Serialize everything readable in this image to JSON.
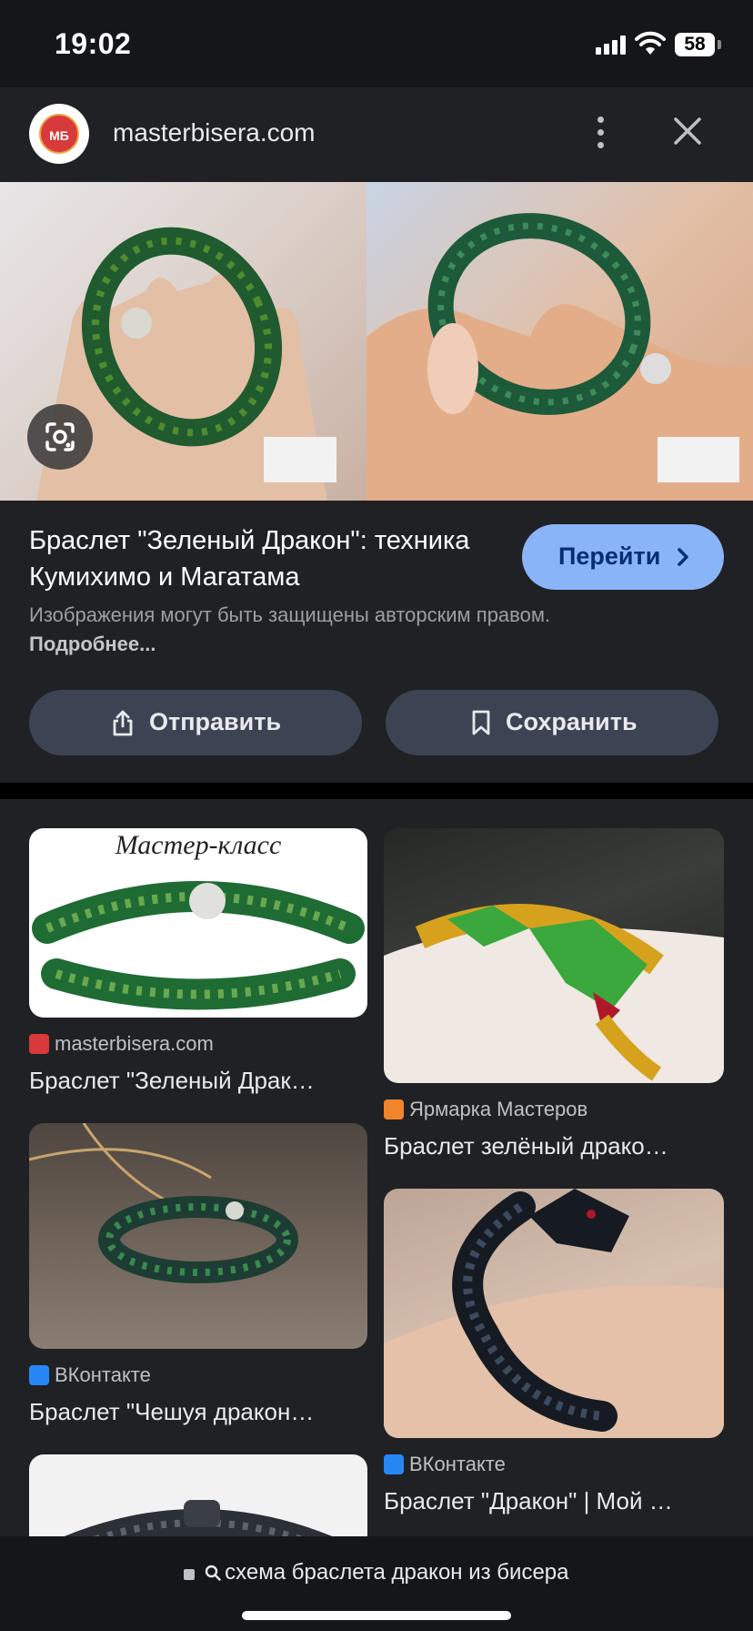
{
  "status": {
    "time": "19:02",
    "battery": "58"
  },
  "header": {
    "logo_text": "МБ",
    "site": "masterbisera.com"
  },
  "preview": {
    "title": "Браслет \"Зеленый Дракон\": техника Кумихимо и Магатама",
    "go_label": "Перейти",
    "copyright_text": "Изображения могут быть защищены авторским правом.",
    "more_label": "Подробнее...",
    "share_label": "Отправить",
    "save_label": "Сохранить"
  },
  "results": [
    {
      "source": "masterbisera.com",
      "title": "Браслет \"Зеленый Драк…",
      "favicon_color": "#d8393a",
      "image_caption": "Мастер-класс"
    },
    {
      "source": "Ярмарка Мастеров",
      "title": "Браслет зелёный драко…",
      "favicon_color": "#f0852c"
    },
    {
      "source": "ВКонтакте",
      "title": "Браслет \"Чешуя дракон…",
      "favicon_color": "#2787f5"
    },
    {
      "source": "ВКонтакте",
      "title": "Браслет \"Дракон\" | Мой …",
      "favicon_color": "#2787f5"
    }
  ],
  "search": {
    "query": "схема браслета дракон из бисера"
  },
  "colors": {
    "accent": "#8ab4f8",
    "background": "#202124",
    "button": "#3c4454"
  }
}
